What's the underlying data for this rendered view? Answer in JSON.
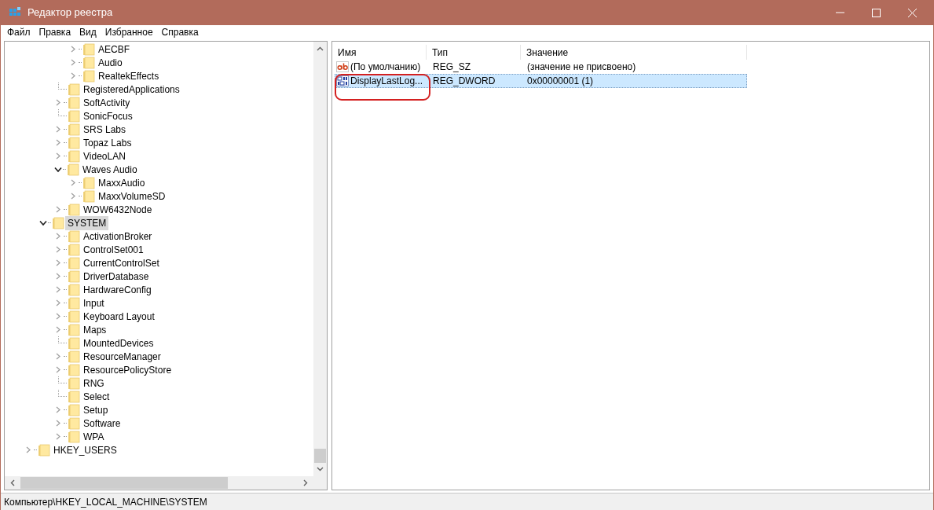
{
  "window": {
    "title": "Редактор реестра"
  },
  "menu": [
    "Файл",
    "Правка",
    "Вид",
    "Избранное",
    "Справка"
  ],
  "tree": [
    {
      "children": [
        {
          "children": [
            {
              "children": [
                {
                  "label": "AECBF",
                  "has_children": true,
                  "expanded": false,
                  "selected": false
                },
                {
                  "label": "Audio",
                  "has_children": true,
                  "expanded": false,
                  "selected": false
                },
                {
                  "label": "RealtekEffects",
                  "has_children": true,
                  "expanded": false,
                  "selected": false
                }
              ]
            },
            {
              "label": "RegisteredApplications",
              "has_children": false,
              "expanded": false,
              "selected": false
            },
            {
              "label": "SoftActivity",
              "has_children": true,
              "expanded": false,
              "selected": false
            },
            {
              "label": "SonicFocus",
              "has_children": false,
              "expanded": false,
              "selected": false
            },
            {
              "label": "SRS Labs",
              "has_children": true,
              "expanded": false,
              "selected": false
            },
            {
              "label": "Topaz Labs",
              "has_children": true,
              "expanded": false,
              "selected": false
            },
            {
              "label": "VideoLAN",
              "has_children": true,
              "expanded": false,
              "selected": false
            },
            {
              "label": "Waves Audio",
              "has_children": true,
              "expanded": true,
              "selected": false,
              "children": [
                {
                  "label": "MaxxAudio",
                  "has_children": true,
                  "expanded": false,
                  "selected": false
                },
                {
                  "label": "MaxxVolumeSD",
                  "has_children": true,
                  "expanded": false,
                  "selected": false
                }
              ]
            },
            {
              "label": "WOW6432Node",
              "has_children": true,
              "expanded": false,
              "selected": false
            }
          ]
        },
        {
          "label": "SYSTEM",
          "has_children": true,
          "expanded": true,
          "selected": true,
          "children": [
            {
              "label": "ActivationBroker",
              "has_children": true,
              "expanded": false,
              "selected": false
            },
            {
              "label": "ControlSet001",
              "has_children": true,
              "expanded": false,
              "selected": false
            },
            {
              "label": "CurrentControlSet",
              "has_children": true,
              "expanded": false,
              "selected": false
            },
            {
              "label": "DriverDatabase",
              "has_children": true,
              "expanded": false,
              "selected": false
            },
            {
              "label": "HardwareConfig",
              "has_children": true,
              "expanded": false,
              "selected": false
            },
            {
              "label": "Input",
              "has_children": true,
              "expanded": false,
              "selected": false
            },
            {
              "label": "Keyboard Layout",
              "has_children": true,
              "expanded": false,
              "selected": false
            },
            {
              "label": "Maps",
              "has_children": true,
              "expanded": false,
              "selected": false
            },
            {
              "label": "MountedDevices",
              "has_children": false,
              "expanded": false,
              "selected": false
            },
            {
              "label": "ResourceManager",
              "has_children": true,
              "expanded": false,
              "selected": false
            },
            {
              "label": "ResourcePolicyStore",
              "has_children": true,
              "expanded": false,
              "selected": false
            },
            {
              "label": "RNG",
              "has_children": false,
              "expanded": false,
              "selected": false
            },
            {
              "label": "Select",
              "has_children": false,
              "expanded": false,
              "selected": false
            },
            {
              "label": "Setup",
              "has_children": true,
              "expanded": false,
              "selected": false
            },
            {
              "label": "Software",
              "has_children": true,
              "expanded": false,
              "selected": false
            },
            {
              "label": "WPA",
              "has_children": true,
              "expanded": false,
              "selected": false
            }
          ]
        }
      ]
    },
    {
      "label": "HKEY_USERS",
      "has_children": true,
      "expanded": false,
      "selected": false
    }
  ],
  "values": {
    "columns": [
      "Имя",
      "Тип",
      "Значение"
    ],
    "rows": [
      {
        "kind": "string",
        "name": "(По умолчанию)",
        "type": "REG_SZ",
        "data": "(значение не присвоено)",
        "selected": false
      },
      {
        "kind": "dword",
        "name": "DisplayLastLog...",
        "type": "REG_DWORD",
        "data": "0x00000001 (1)",
        "selected": true
      }
    ]
  },
  "status_bar": "Компьютер\\HKEY_LOCAL_MACHINE\\SYSTEM"
}
